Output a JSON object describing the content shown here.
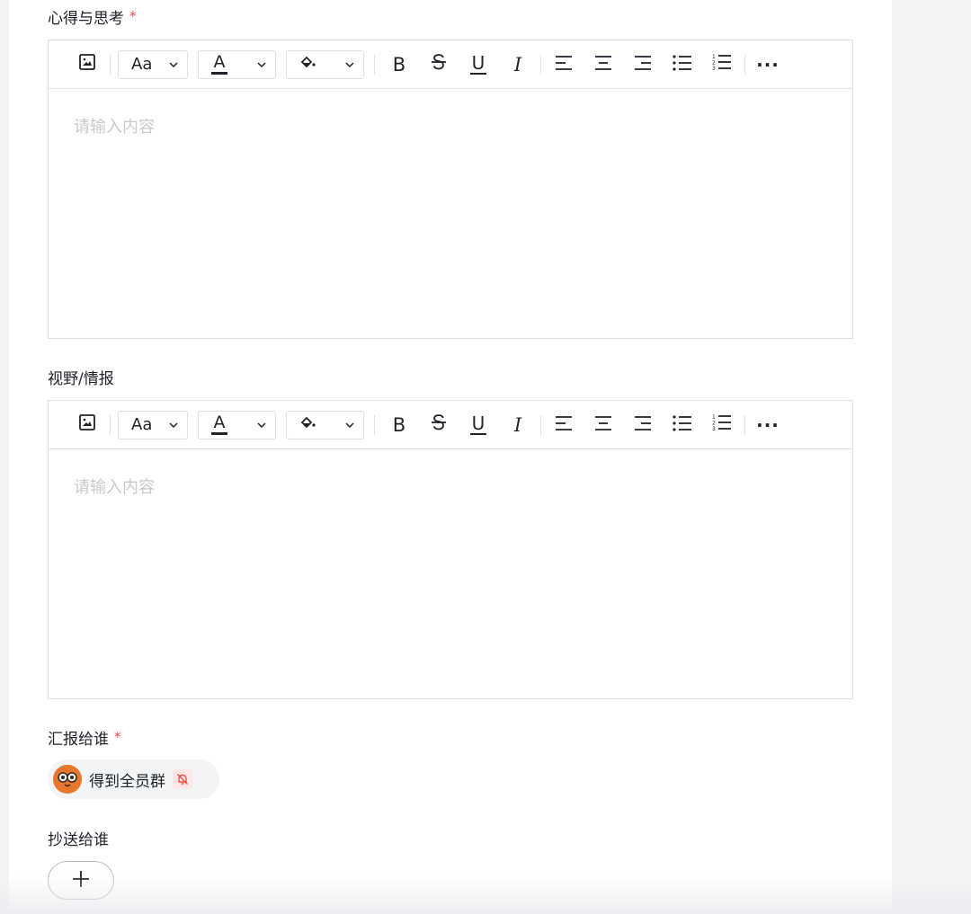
{
  "section1": {
    "label": "心得与思考",
    "required_mark": "*",
    "placeholder": "请输入内容"
  },
  "section2": {
    "label": "视野/情报",
    "placeholder": "请输入内容"
  },
  "report_to": {
    "label": "汇报给谁",
    "required_mark": "*",
    "chip_name": "得到全员群"
  },
  "cc_to": {
    "label": "抄送给谁",
    "add_label": "+"
  },
  "toolbar": {
    "font_size_label": "Aa",
    "font_color_label": "A",
    "bold_label": "B",
    "underline_label": "U",
    "italic_label": "I",
    "more_label": "···"
  },
  "icons": [
    "image-icon",
    "font-size-icon",
    "font-color-icon",
    "fill-color-icon",
    "bold-icon",
    "strikethrough-icon",
    "underline-icon",
    "italic-icon",
    "align-left-icon",
    "align-center-icon",
    "align-right-icon",
    "bullet-list-icon",
    "numbered-list-icon",
    "more-icon",
    "mute-icon",
    "plus-icon"
  ],
  "colors": {
    "required": "#f54a45",
    "placeholder": "#c8cacd",
    "border": "#dee0e3",
    "avatar_bg": "#e8772e",
    "mute_icon": "#f54a45"
  }
}
